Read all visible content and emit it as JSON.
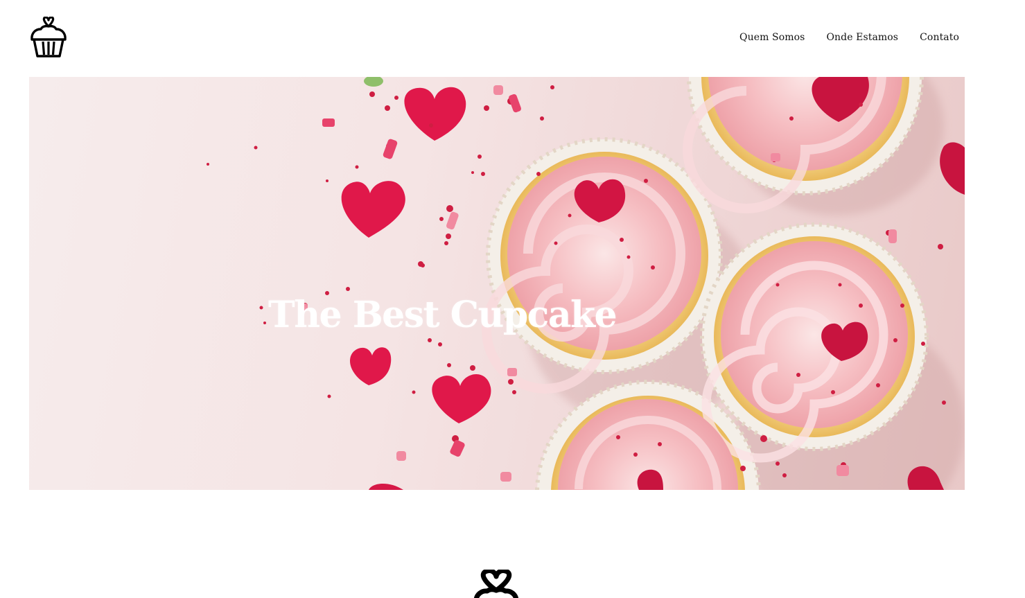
{
  "header": {
    "logo_icon": "cupcake-heart-icon",
    "nav": [
      {
        "label": "Quem Somos"
      },
      {
        "label": "Onde Estamos"
      },
      {
        "label": "Contato"
      }
    ]
  },
  "hero": {
    "title": "The Best Cupcake",
    "background": "pink-frosted-cupcakes-with-hearts-photo"
  },
  "footer": {
    "icon": "heart-knot-icon"
  },
  "colors": {
    "accent": "#e8174d",
    "frosting": "#f7c2c5",
    "text": "#111111"
  }
}
